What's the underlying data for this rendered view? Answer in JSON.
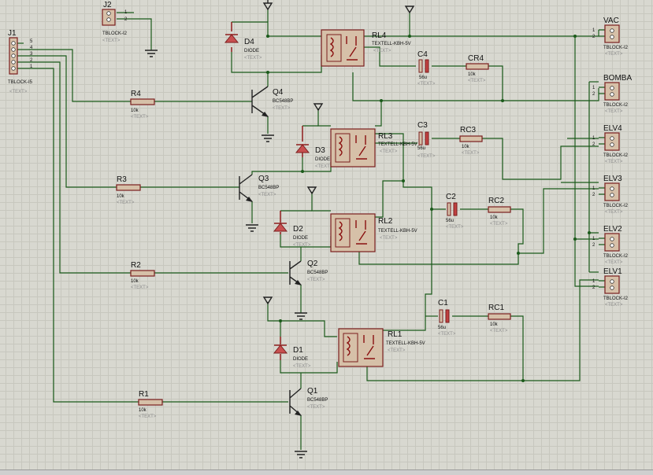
{
  "connectors": [
    {
      "id": "J1",
      "ref": "J1",
      "value": "TBLOCK-I5",
      "text": "<TEXT>",
      "pins": [
        "5",
        "4",
        "3",
        "2",
        "1"
      ]
    },
    {
      "id": "J2",
      "ref": "J2",
      "value": "TBLOCK-I2",
      "text": "<TEXT>",
      "pins": [
        "1",
        "2"
      ]
    },
    {
      "id": "VAC",
      "ref": "VAC",
      "value": "TBLOCK-I2",
      "text": "<TEXT>",
      "pins": [
        "1",
        "2"
      ]
    },
    {
      "id": "BOMBA",
      "ref": "BOMBA",
      "value": "TBLOCK-I2",
      "text": "<TEXT>",
      "pins": [
        "1",
        "2"
      ]
    },
    {
      "id": "ELV4",
      "ref": "ELV4",
      "value": "TBLOCK-I2",
      "text": "<TEXT>",
      "pins": [
        "1",
        "2"
      ]
    },
    {
      "id": "ELV3",
      "ref": "ELV3",
      "value": "TBLOCK-I2",
      "text": "<TEXT>",
      "pins": [
        "1",
        "2"
      ]
    },
    {
      "id": "ELV2",
      "ref": "ELV2",
      "value": "TBLOCK-I2",
      "text": "<TEXT>",
      "pins": [
        "1",
        "2"
      ]
    },
    {
      "id": "ELV1",
      "ref": "ELV1",
      "value": "TBLOCK-I2",
      "text": "<TEXT>",
      "pins": [
        "1",
        "2"
      ]
    }
  ],
  "relays": [
    {
      "id": "RL4",
      "ref": "RL4",
      "value": "TEXTELL-KBH-5V",
      "text": "<TEXT>"
    },
    {
      "id": "RL3",
      "ref": "RL3",
      "value": "TEXTELL-KBH-5V",
      "text": "<TEXT>"
    },
    {
      "id": "RL2",
      "ref": "RL2",
      "value": "TEXTELL-KBH-5V",
      "text": "<TEXT>"
    },
    {
      "id": "RL1",
      "ref": "RL1",
      "value": "TEXTELL-KBH-5V",
      "text": "<TEXT>"
    }
  ],
  "diodes": [
    {
      "id": "D4",
      "ref": "D4",
      "value": "DIODE",
      "text": "<TEXT>"
    },
    {
      "id": "D3",
      "ref": "D3",
      "value": "DIODE",
      "text": "<TEXT>"
    },
    {
      "id": "D2",
      "ref": "D2",
      "value": "DIODE",
      "text": "<TEXT>"
    },
    {
      "id": "D1",
      "ref": "D1",
      "value": "DIODE",
      "text": "<TEXT>"
    }
  ],
  "transistors": [
    {
      "id": "Q4",
      "ref": "Q4",
      "value": "BC548BP",
      "text": "<TEXT>"
    },
    {
      "id": "Q3",
      "ref": "Q3",
      "value": "BC548BP",
      "text": "<TEXT>"
    },
    {
      "id": "Q2",
      "ref": "Q2",
      "value": "BC548BP",
      "text": "<TEXT>"
    },
    {
      "id": "Q1",
      "ref": "Q1",
      "value": "BC548BP",
      "text": "<TEXT>"
    }
  ],
  "resistors": [
    {
      "id": "R4",
      "ref": "R4",
      "value": "10k",
      "text": "<TEXT>"
    },
    {
      "id": "R3",
      "ref": "R3",
      "value": "10k",
      "text": "<TEXT>"
    },
    {
      "id": "R2",
      "ref": "R2",
      "value": "10k",
      "text": "<TEXT>"
    },
    {
      "id": "R1",
      "ref": "R1",
      "value": "10k",
      "text": "<TEXT>"
    },
    {
      "id": "CR4",
      "ref": "CR4",
      "value": "10k",
      "text": "<TEXT>"
    },
    {
      "id": "RC3",
      "ref": "RC3",
      "value": "10k",
      "text": "<TEXT>"
    },
    {
      "id": "RC2",
      "ref": "RC2",
      "value": "10k",
      "text": "<TEXT>"
    },
    {
      "id": "RC1",
      "ref": "RC1",
      "value": "10k",
      "text": "<TEXT>"
    }
  ],
  "capacitors": [
    {
      "id": "C4",
      "ref": "C4",
      "value": "56u",
      "text": "<TEXT>"
    },
    {
      "id": "C3",
      "ref": "C3",
      "value": "56u",
      "text": "<TEXT>"
    },
    {
      "id": "C2",
      "ref": "C2",
      "value": "56u",
      "text": "<TEXT>"
    },
    {
      "id": "C1",
      "ref": "C1",
      "value": "56u",
      "text": "<TEXT>"
    }
  ],
  "colors": {
    "wire": "#1a5a1a",
    "body": "#d6c0a8",
    "outline": "#7a1e1e",
    "grid": "#c7c7be",
    "background": "#d8d8d0"
  }
}
